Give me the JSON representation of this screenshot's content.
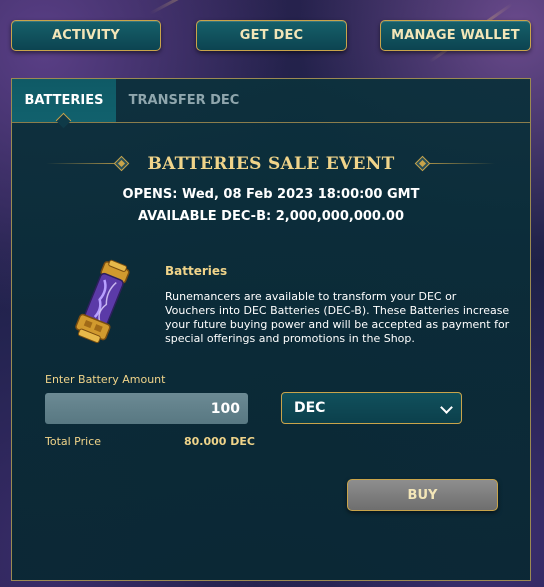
{
  "topnav": {
    "activity_label": "ACTIVITY",
    "get_dec_label": "GET DEC",
    "manage_wallet_label": "MANAGE WALLET"
  },
  "tabs": [
    {
      "label": "BATTERIES",
      "active": true
    },
    {
      "label": "TRANSFER DEC",
      "active": false
    }
  ],
  "sale": {
    "title": "BATTERIES SALE EVENT",
    "opens": "OPENS: Wed, 08 Feb 2023 18:00:00 GMT",
    "available": "AVAILABLE DEC-B: 2,000,000,000.00"
  },
  "product": {
    "icon": "battery-icon",
    "title": "Batteries",
    "description": "Runemancers are available to transform your DEC or Vouchers into DEC Batteries (DEC-B). These Batteries increase your future buying power and will be accepted as payment for special offerings and promotions in the Shop."
  },
  "form": {
    "amount_label": "Enter Battery Amount",
    "amount_value": "100",
    "currency_selected": "DEC",
    "total_label": "Total Price",
    "total_value": "80.000 DEC",
    "buy_label": "BUY"
  },
  "colors": {
    "accent_gold": "#c9a44a",
    "title_gold": "#f0d48a",
    "teal": "#0f5a66"
  }
}
